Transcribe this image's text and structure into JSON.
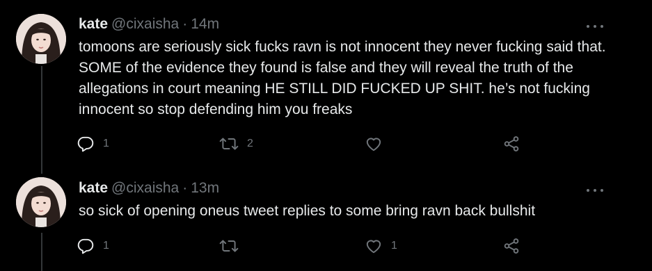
{
  "tweets": [
    {
      "name": "kate",
      "handle": "@cixaisha",
      "separator": "·",
      "time": "14m",
      "text": "tomoons are seriously sick fucks ravn is not innocent they never fucking said that. SOME of the evidence they found is false and they will reveal the truth of the allegations in court meaning HE STILL DID FUCKED UP SHIT. he’s not fucking innocent so stop defending him you freaks",
      "replies": "1",
      "retweets": "2",
      "likes": ""
    },
    {
      "name": "kate",
      "handle": "@cixaisha",
      "separator": "·",
      "time": "13m",
      "text": "so sick of opening oneus tweet replies to some bring ravn back bullshit",
      "replies": "1",
      "retweets": "",
      "likes": "1"
    }
  ],
  "colors": {
    "background": "#000000",
    "primary_text": "#e7e9ea",
    "secondary_text": "#71767b",
    "thread_line": "#333639"
  },
  "icons": [
    "more-icon",
    "reply-icon",
    "retweet-icon",
    "like-icon",
    "share-icon"
  ]
}
